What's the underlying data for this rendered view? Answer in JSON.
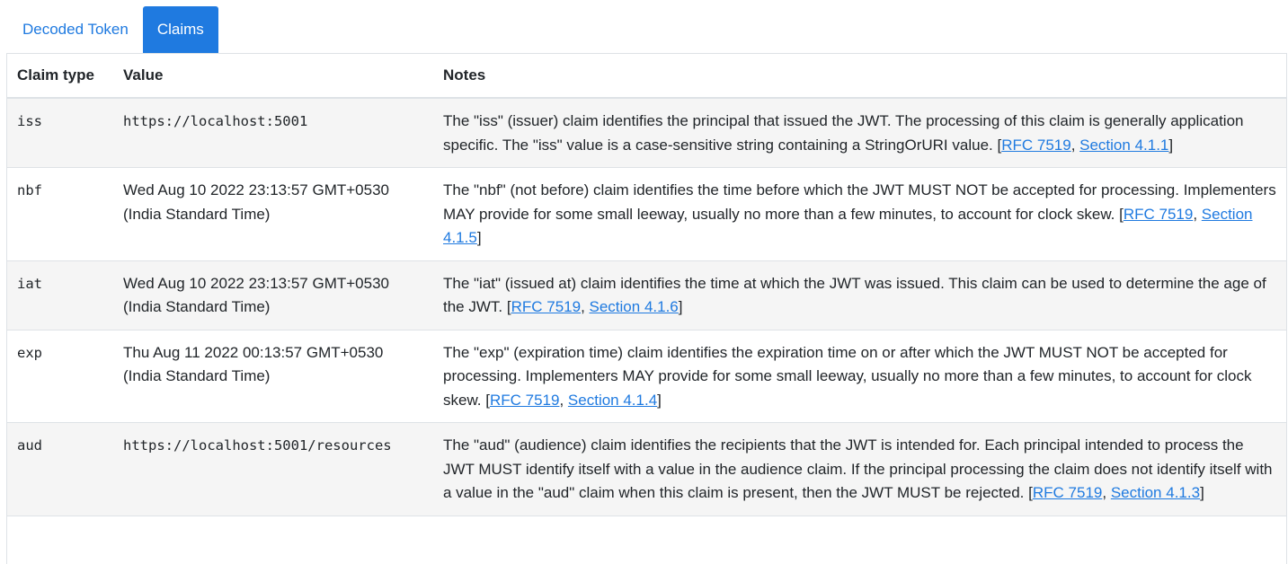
{
  "tabs": [
    {
      "label": "Decoded Token",
      "active": false
    },
    {
      "label": "Claims",
      "active": true
    }
  ],
  "table": {
    "headers": {
      "claim_type": "Claim type",
      "value": "Value",
      "notes": "Notes"
    },
    "rows": [
      {
        "claim": "iss",
        "value": "https://localhost:5001",
        "value_mono": true,
        "note": "The \"iss\" (issuer) claim identifies the principal that issued the JWT. The processing of this claim is generally application specific. The \"iss\" value is a case-sensitive string containing a StringOrURI value.",
        "rfc": "RFC 7519",
        "section": "Section 4.1.1"
      },
      {
        "claim": "nbf",
        "value": "Wed Aug 10 2022 23:13:57 GMT+0530 (India Standard Time)",
        "value_mono": false,
        "note": "The \"nbf\" (not before) claim identifies the time before which the JWT MUST NOT be accepted for processing. Implementers MAY provide for some small leeway, usually no more than a few minutes, to account for clock skew.",
        "rfc": "RFC 7519",
        "section": "Section 4.1.5"
      },
      {
        "claim": "iat",
        "value": "Wed Aug 10 2022 23:13:57 GMT+0530 (India Standard Time)",
        "value_mono": false,
        "note": "The \"iat\" (issued at) claim identifies the time at which the JWT was issued. This claim can be used to determine the age of the JWT.",
        "rfc": "RFC 7519",
        "section": "Section 4.1.6"
      },
      {
        "claim": "exp",
        "value": "Thu Aug 11 2022 00:13:57 GMT+0530 (India Standard Time)",
        "value_mono": false,
        "note": "The \"exp\" (expiration time) claim identifies the expiration time on or after which the JWT MUST NOT be accepted for processing. Implementers MAY provide for some small leeway, usually no more than a few minutes, to account for clock skew.",
        "rfc": "RFC 7519",
        "section": "Section 4.1.4"
      },
      {
        "claim": "aud",
        "value": "https://localhost:5001/resources",
        "value_mono": true,
        "note": "The \"aud\" (audience) claim identifies the recipients that the JWT is intended for. Each principal intended to process the JWT MUST identify itself with a value in the audience claim. If the principal processing the claim does not identify itself with a value in the \"aud\" claim when this claim is present, then the JWT MUST be rejected.",
        "rfc": "RFC 7519",
        "section": "Section 4.1.3"
      }
    ]
  },
  "colors": {
    "accent": "#1f7ae0",
    "stripe": "#f5f5f5",
    "border": "#dee2e6"
  }
}
